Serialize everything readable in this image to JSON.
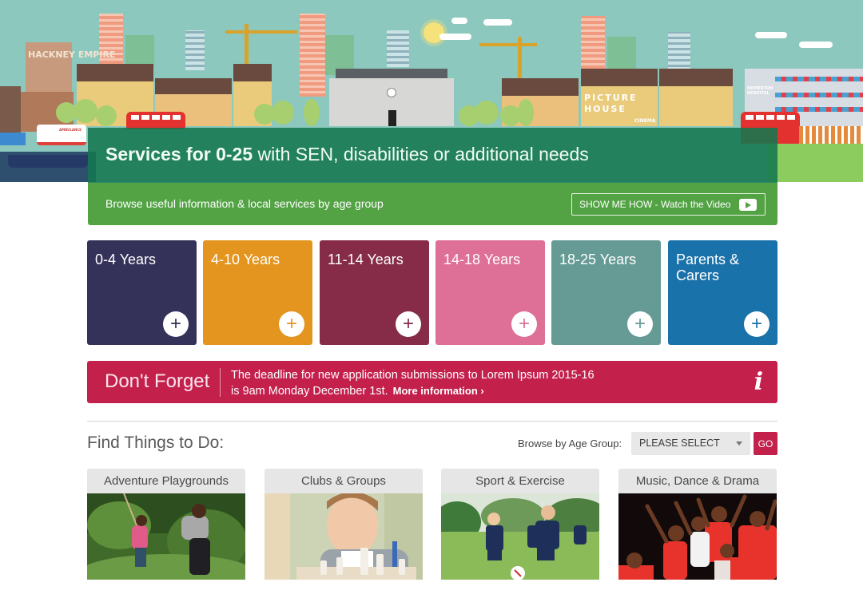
{
  "hero": {
    "landmarks": [
      "HACKNEY EMPIRE",
      "PICTURE HOUSE",
      "CINEMA",
      "HOMERTON HOSPITAL",
      "AMBULANCE"
    ],
    "title_bold": "Services for 0-25",
    "title_rest": " with SEN, disabilities or additional needs",
    "subtitle": "Browse useful information & local services by age group",
    "video_button": {
      "label": "SHOW ME HOW - Watch the Video",
      "icon": "play-icon"
    }
  },
  "age_groups": [
    {
      "label": "0-4 Years",
      "color": "#35325a",
      "plus_color": "#35325a"
    },
    {
      "label": "4-10 Years",
      "color": "#e3951f",
      "plus_color": "#e3951f"
    },
    {
      "label": "11-14 Years",
      "color": "#862c48",
      "plus_color": "#862c48"
    },
    {
      "label": "14-18 Years",
      "color": "#de6f96",
      "plus_color": "#de6f96"
    },
    {
      "label": "18-25 Years",
      "color": "#669b95",
      "plus_color": "#669b95"
    },
    {
      "label": "Parents & Carers",
      "color": "#1a72aa",
      "plus_color": "#1a72aa"
    }
  ],
  "notice": {
    "heading": "Don't Forget",
    "line1": "The deadline for new application submissions to Lorem Ipsum 2015-16",
    "line2": "is 9am Monday December 1st.",
    "more_link": "More information ›",
    "icon": "info-icon"
  },
  "find": {
    "title": "Find Things to Do:",
    "browse_label": "Browse by Age Group:",
    "select_value": "PLEASE SELECT",
    "go_label": "GO",
    "activities": [
      {
        "label": "Adventure Playgrounds",
        "image": "children-on-rope-swing"
      },
      {
        "label": "Clubs & Groups",
        "image": "boy-playing-chess"
      },
      {
        "label": "Sport & Exercise",
        "image": "kids-playing-football"
      },
      {
        "label": "Music, Dance & Drama",
        "image": "children-performing-on-stage"
      }
    ]
  },
  "colors": {
    "sky": "#8cc8bd",
    "title_band": "#147850",
    "sub_band": "#53a345",
    "notice": "#c3204c",
    "go": "#c3204c"
  }
}
